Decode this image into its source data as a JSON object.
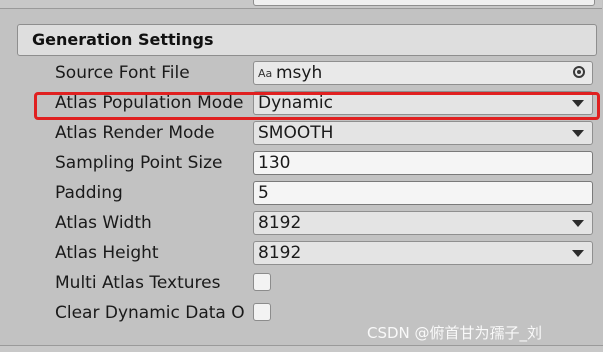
{
  "section": {
    "title": "Generation Settings"
  },
  "fields": {
    "source_font": {
      "label": "Source Font File",
      "value": "msyh",
      "icon": "Aa"
    },
    "atlas_population_mode": {
      "label": "Atlas Population Mode",
      "value": "Dynamic"
    },
    "atlas_render_mode": {
      "label": "Atlas Render Mode",
      "value": "SMOOTH"
    },
    "sampling_point_size": {
      "label": "Sampling Point Size",
      "value": "130"
    },
    "padding": {
      "label": "Padding",
      "value": "5"
    },
    "atlas_width": {
      "label": "Atlas Width",
      "value": "8192"
    },
    "atlas_height": {
      "label": "Atlas Height",
      "value": "8192"
    },
    "multi_atlas": {
      "label": "Multi Atlas Textures"
    },
    "clear_dynamic": {
      "label": "Clear Dynamic Data O"
    }
  },
  "highlight_color": "#e02020",
  "watermark": "CSDN @俯首甘为孺子_刘"
}
